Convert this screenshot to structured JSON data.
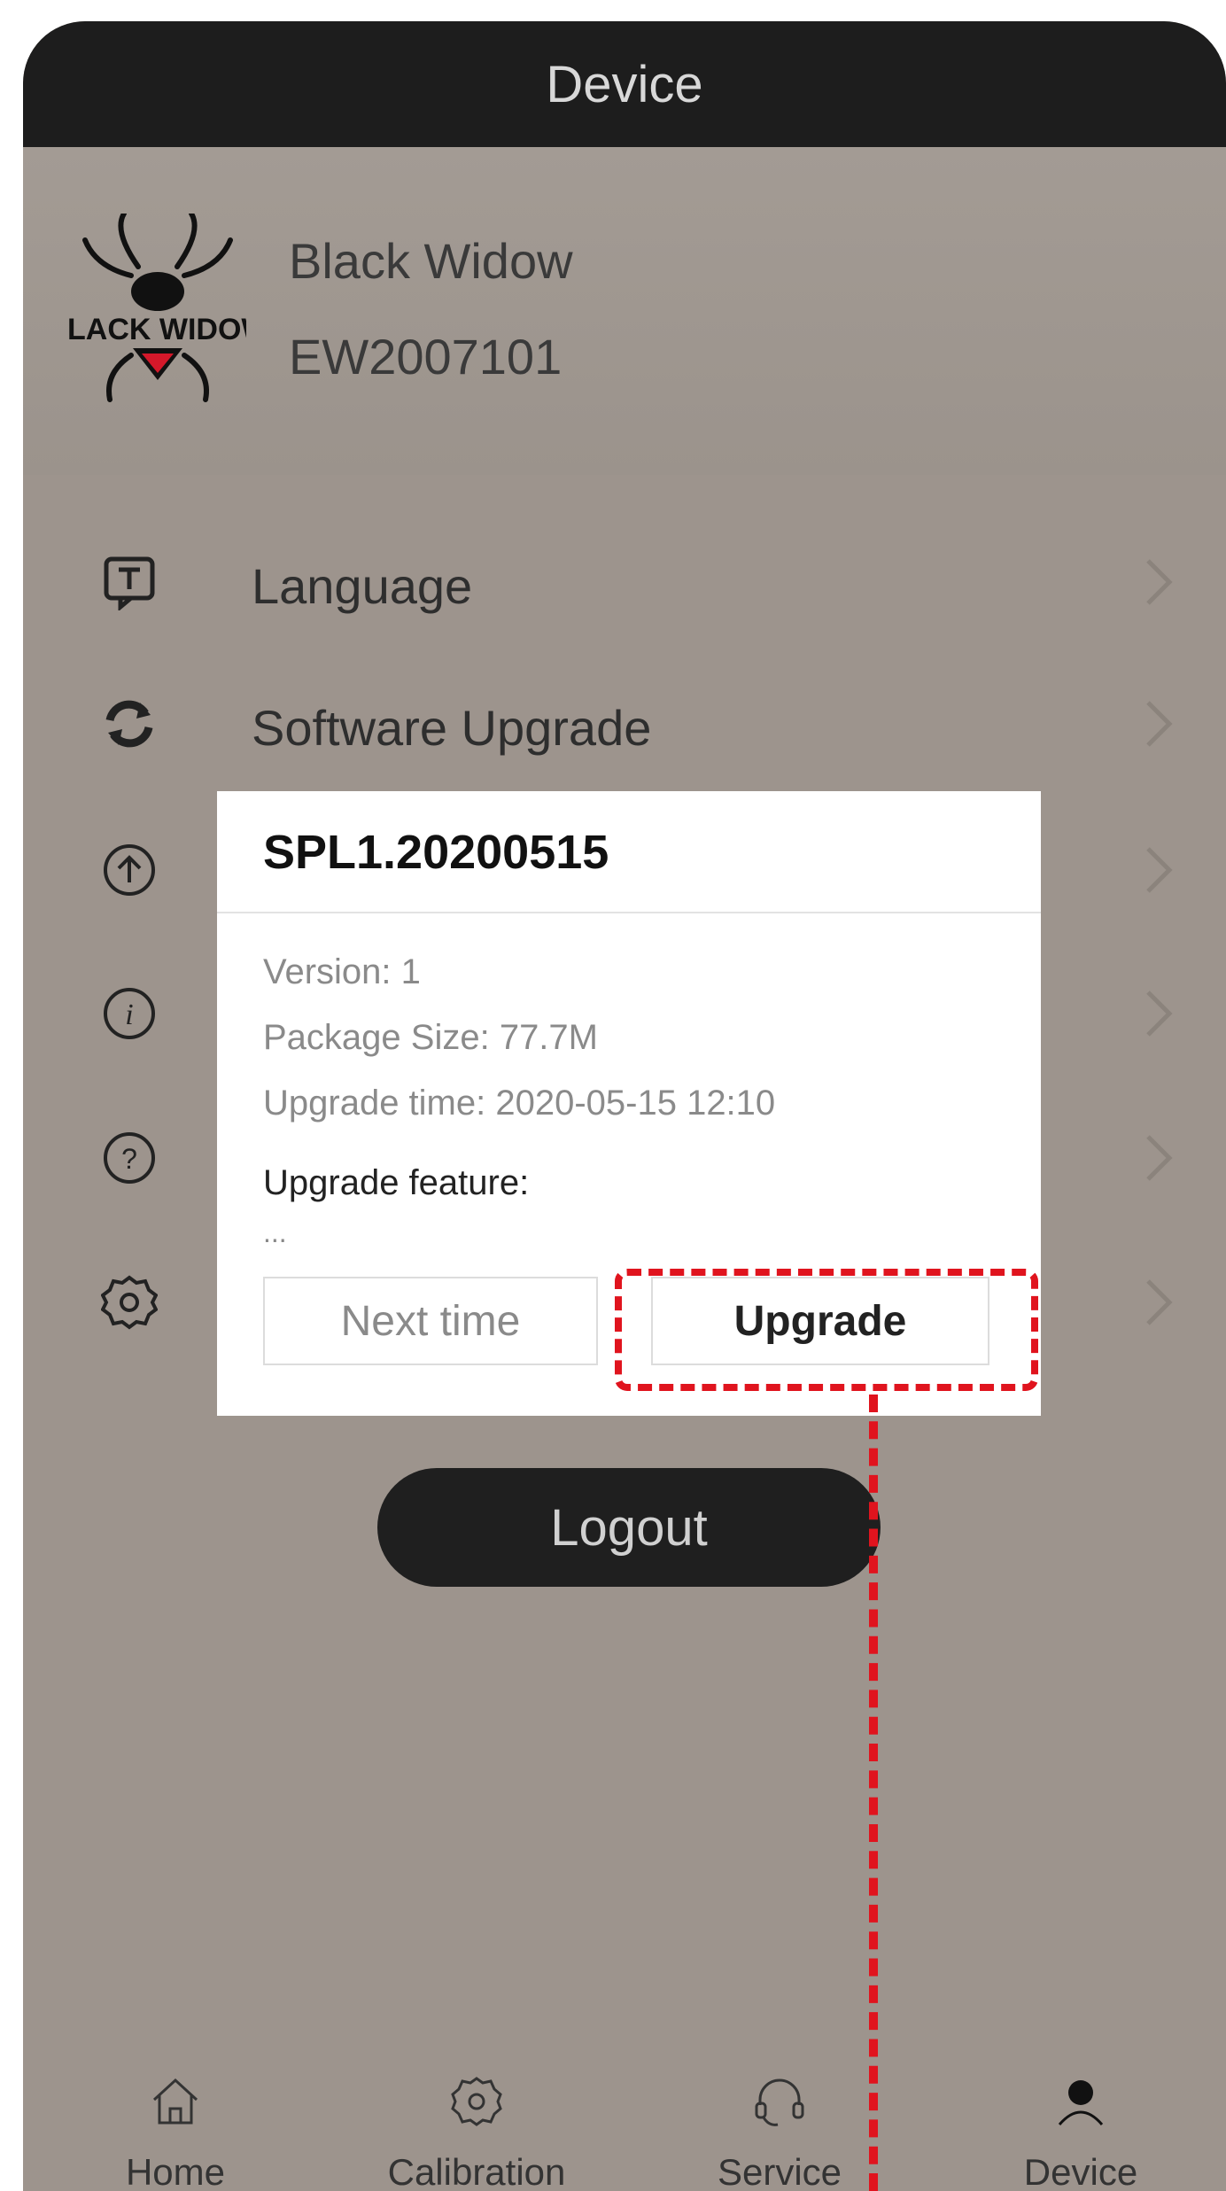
{
  "header": {
    "title": "Device"
  },
  "profile": {
    "brand": "Black Widow",
    "serial": "EW2007101",
    "logo_text": "BLACK WIDOW"
  },
  "menu": [
    {
      "label": "Language",
      "icon": "translate-icon"
    },
    {
      "label": "Software Upgrade",
      "icon": "refresh-icon"
    },
    {
      "label": "",
      "icon": "upload-circle-icon"
    },
    {
      "label": "",
      "icon": "info-icon"
    },
    {
      "label": "",
      "icon": "help-icon"
    },
    {
      "label": "",
      "icon": "gear-icon"
    }
  ],
  "dialog": {
    "title": "SPL1.20200515",
    "version": "Version: 1",
    "package_size": "Package Size: 77.7M",
    "upgrade_time": "Upgrade time: 2020-05-15 12:10",
    "feature_label": "Upgrade feature:",
    "feature_text": "...",
    "next_label": "Next time",
    "upgrade_label": "Upgrade"
  },
  "logout_label": "Logout",
  "tabs": [
    {
      "label": "Home",
      "icon": "home-icon"
    },
    {
      "label": "Calibration",
      "icon": "gear-icon"
    },
    {
      "label": "Service",
      "icon": "headset-icon"
    },
    {
      "label": "Device",
      "icon": "user-icon",
      "active": true
    }
  ],
  "colors": {
    "annotation": "#e0141e",
    "header": "#1d1d1d",
    "backdrop": "#9d948d"
  }
}
